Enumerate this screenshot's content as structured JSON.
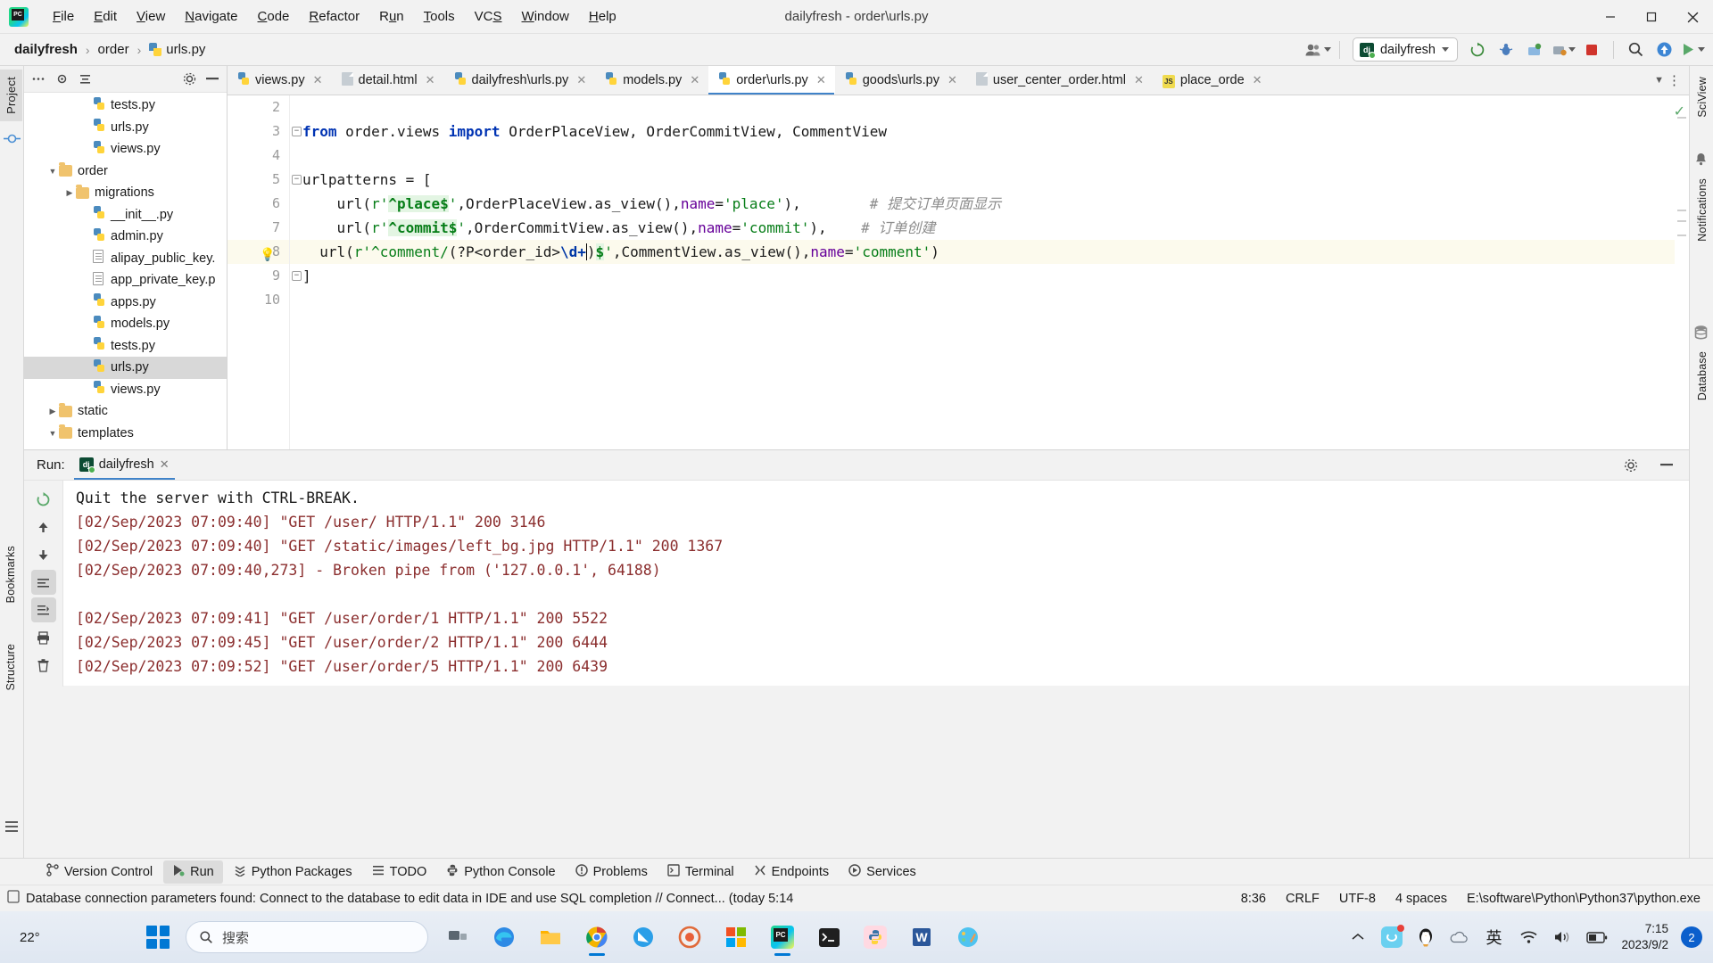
{
  "window": {
    "title": "dailyfresh - order\\urls.py",
    "minimize": "—",
    "maximize": "☐",
    "close": "✕"
  },
  "menubar": [
    {
      "label": "File"
    },
    {
      "label": "Edit"
    },
    {
      "label": "View"
    },
    {
      "label": "Navigate"
    },
    {
      "label": "Code"
    },
    {
      "label": "Refactor"
    },
    {
      "label": "Run"
    },
    {
      "label": "Tools"
    },
    {
      "label": "VCS"
    },
    {
      "label": "Window"
    },
    {
      "label": "Help"
    }
  ],
  "breadcrumb": {
    "project": "dailyfresh",
    "folder": "order",
    "file": "urls.py",
    "sep": "›"
  },
  "toolbar": {
    "run_config": "dailyfresh",
    "dj_badge": "dj",
    "icons": [
      "user-avatar-icon",
      "update-project-icon",
      "debug-icon",
      "coverage-icon",
      "profile-icon",
      "stop-icon",
      "search-everywhere-icon",
      "updates-icon",
      "run-icon"
    ]
  },
  "left_strip": {
    "tabs": [
      "Project",
      "Commit"
    ]
  },
  "right_strip": {
    "tabs": [
      "SciView",
      "Notifications",
      "Database"
    ]
  },
  "project_tree": {
    "header_title": "",
    "items": [
      {
        "label": "tests.py",
        "type": "py",
        "indent": 3,
        "arrow": "",
        "selected": false
      },
      {
        "label": "urls.py",
        "type": "py",
        "indent": 3,
        "arrow": "",
        "selected": false
      },
      {
        "label": "views.py",
        "type": "py",
        "indent": 3,
        "arrow": "",
        "selected": false
      },
      {
        "label": "order",
        "type": "folder",
        "indent": 1,
        "arrow": "▼",
        "selected": false
      },
      {
        "label": "migrations",
        "type": "folder",
        "indent": 2,
        "arrow": "▶",
        "selected": false
      },
      {
        "label": "__init__.py",
        "type": "py",
        "indent": 3,
        "arrow": "",
        "selected": false
      },
      {
        "label": "admin.py",
        "type": "py",
        "indent": 3,
        "arrow": "",
        "selected": false
      },
      {
        "label": "alipay_public_key.",
        "type": "txt",
        "indent": 3,
        "arrow": "",
        "selected": false
      },
      {
        "label": "app_private_key.p",
        "type": "txt",
        "indent": 3,
        "arrow": "",
        "selected": false
      },
      {
        "label": "apps.py",
        "type": "py",
        "indent": 3,
        "arrow": "",
        "selected": false
      },
      {
        "label": "models.py",
        "type": "py",
        "indent": 3,
        "arrow": "",
        "selected": false
      },
      {
        "label": "tests.py",
        "type": "py",
        "indent": 3,
        "arrow": "",
        "selected": false
      },
      {
        "label": "urls.py",
        "type": "py",
        "indent": 3,
        "arrow": "",
        "selected": true
      },
      {
        "label": "views.py",
        "type": "py",
        "indent": 3,
        "arrow": "",
        "selected": false
      },
      {
        "label": "static",
        "type": "folder",
        "indent": 1,
        "arrow": "▶",
        "selected": false
      },
      {
        "label": "templates",
        "type": "folder",
        "indent": 1,
        "arrow": "▼",
        "selected": false
      }
    ]
  },
  "editor_tabs": [
    {
      "label": "views.py",
      "icon": "py",
      "active": false
    },
    {
      "label": "detail.html",
      "icon": "html",
      "active": false
    },
    {
      "label": "dailyfresh\\urls.py",
      "icon": "py",
      "active": false
    },
    {
      "label": "models.py",
      "icon": "py",
      "active": false
    },
    {
      "label": "order\\urls.py",
      "icon": "py",
      "active": true
    },
    {
      "label": "goods\\urls.py",
      "icon": "py",
      "active": false
    },
    {
      "label": "user_center_order.html",
      "icon": "html",
      "active": false
    },
    {
      "label": "place_orde",
      "icon": "js",
      "active": false
    }
  ],
  "editor": {
    "file_name": "order\\urls.py",
    "lines": [
      {
        "num": "2",
        "segments": [],
        "fold": "",
        "bulb": false,
        "highlight": false
      },
      {
        "num": "3",
        "fold": "−",
        "bulb": false,
        "highlight": false,
        "segments": [
          {
            "t": "from",
            "c": "kw"
          },
          {
            "t": " order.views ",
            "c": ""
          },
          {
            "t": "import",
            "c": "kw"
          },
          {
            "t": " OrderPlaceView, OrderCommitView, CommentView",
            "c": ""
          }
        ]
      },
      {
        "num": "4",
        "segments": [],
        "fold": "",
        "bulb": false,
        "highlight": false
      },
      {
        "num": "5",
        "fold": "−",
        "bulb": false,
        "highlight": false,
        "segments": [
          {
            "t": "urlpatterns = [",
            "c": ""
          }
        ]
      },
      {
        "num": "6",
        "fold": "",
        "bulb": false,
        "highlight": false,
        "segments": [
          {
            "t": "    url(",
            "c": ""
          },
          {
            "t": "r'",
            "c": "str"
          },
          {
            "t": "^place$",
            "c": "strhl"
          },
          {
            "t": "'",
            "c": "str"
          },
          {
            "t": ",OrderPlaceView.as_view(),",
            "c": ""
          },
          {
            "t": "name",
            "c": "kwarg"
          },
          {
            "t": "=",
            "c": ""
          },
          {
            "t": "'place'",
            "c": "str"
          },
          {
            "t": "),",
            "c": ""
          },
          {
            "t": "        # 提交订单页面显示",
            "c": "cmt"
          }
        ]
      },
      {
        "num": "7",
        "fold": "",
        "bulb": false,
        "highlight": false,
        "segments": [
          {
            "t": "    url(",
            "c": ""
          },
          {
            "t": "r'",
            "c": "str"
          },
          {
            "t": "^commit$",
            "c": "strhl"
          },
          {
            "t": "'",
            "c": "str"
          },
          {
            "t": ",OrderCommitView.as_view(),",
            "c": ""
          },
          {
            "t": "name",
            "c": "kwarg"
          },
          {
            "t": "=",
            "c": ""
          },
          {
            "t": "'commit'",
            "c": "str"
          },
          {
            "t": "),",
            "c": ""
          },
          {
            "t": "    # 订单创建",
            "c": "cmt"
          }
        ]
      },
      {
        "num": "8",
        "fold": "",
        "bulb": true,
        "highlight": true,
        "segments": [
          {
            "t": "  url(",
            "c": ""
          },
          {
            "t": "r'",
            "c": "str"
          },
          {
            "t": "^comment/",
            "c": "str"
          },
          {
            "t": "(?P<",
            "c": "sel"
          },
          {
            "t": "order_id",
            "c": ""
          },
          {
            "t": ">",
            "c": ""
          },
          {
            "t": "\\d+",
            "c": "regex"
          },
          {
            "t": ")",
            "c": "sel"
          },
          {
            "t": "$",
            "c": "strhl"
          },
          {
            "t": "'",
            "c": "str"
          },
          {
            "t": ",CommentView.as_view(),",
            "c": ""
          },
          {
            "t": "name",
            "c": "kwarg"
          },
          {
            "t": "=",
            "c": ""
          },
          {
            "t": "'comment'",
            "c": "str"
          },
          {
            "t": ")",
            "c": ""
          }
        ]
      },
      {
        "num": "9",
        "fold": "−",
        "bulb": false,
        "highlight": false,
        "segments": [
          {
            "t": "]",
            "c": ""
          }
        ]
      },
      {
        "num": "10",
        "segments": [],
        "fold": "",
        "bulb": false,
        "highlight": false
      }
    ],
    "bulb_glyph": "💡",
    "inspection_ok": "✓"
  },
  "run_panel": {
    "run_label": "Run:",
    "tab_label": "dailyfresh",
    "close_glyph": "✕",
    "console_lines": [
      {
        "text": "Quit the server with CTRL-BREAK.",
        "color": "dark"
      },
      {
        "text": "[02/Sep/2023 07:09:40] \"GET /user/ HTTP/1.1\" 200 3146",
        "color": "red"
      },
      {
        "text": "[02/Sep/2023 07:09:40] \"GET /static/images/left_bg.jpg HTTP/1.1\" 200 1367",
        "color": "red"
      },
      {
        "text": "[02/Sep/2023 07:09:40,273] - Broken pipe from ('127.0.0.1', 64188)",
        "color": "red"
      },
      {
        "text": "",
        "color": "red"
      },
      {
        "text": "[02/Sep/2023 07:09:41] \"GET /user/order/1 HTTP/1.1\" 200 5522",
        "color": "red"
      },
      {
        "text": "[02/Sep/2023 07:09:45] \"GET /user/order/2 HTTP/1.1\" 200 6444",
        "color": "red"
      },
      {
        "text": "[02/Sep/2023 07:09:52] \"GET /user/order/5 HTTP/1.1\" 200 6439",
        "color": "red"
      }
    ]
  },
  "bottom_tabs": [
    {
      "label": "Version Control",
      "icon": "branch-icon",
      "selected": false
    },
    {
      "label": "Run",
      "icon": "play-icon",
      "selected": true
    },
    {
      "label": "Python Packages",
      "icon": "packages-icon",
      "selected": false
    },
    {
      "label": "TODO",
      "icon": "list-icon",
      "selected": false
    },
    {
      "label": "Python Console",
      "icon": "python-icon",
      "selected": false
    },
    {
      "label": "Problems",
      "icon": "problems-icon",
      "selected": false
    },
    {
      "label": "Terminal",
      "icon": "terminal-icon",
      "selected": false
    },
    {
      "label": "Endpoints",
      "icon": "endpoints-icon",
      "selected": false
    },
    {
      "label": "Services",
      "icon": "services-icon",
      "selected": false
    }
  ],
  "statusbar": {
    "message": "Database connection parameters found: Connect to the database to edit data in IDE and use SQL completion // Connect... (today 5:14",
    "caret": "8:36",
    "line_sep": "CRLF",
    "encoding": "UTF-8",
    "indent": "4 spaces",
    "interpreter": "E:\\software\\Python\\Python37\\python.exe"
  },
  "taskbar": {
    "weather_temp": "22°",
    "search_placeholder": "搜索",
    "ime": "英",
    "clock_time": "7:15",
    "clock_date": "2023/9/2",
    "notification_count": "2",
    "apps": [
      "task-view-icon",
      "edge-icon",
      "file-explorer-icon",
      "chrome-icon",
      "firefox-icon",
      "browser-icon",
      "store-icon",
      "pycharm-icon",
      "terminal-icon",
      "python-icon",
      "word-icon",
      "paint-icon"
    ],
    "tray": [
      "chevron-up-icon",
      "app-icon",
      "qq-icon",
      "cloud-icon",
      "ime-icon",
      "wifi-icon",
      "volume-icon",
      "battery-icon"
    ]
  }
}
